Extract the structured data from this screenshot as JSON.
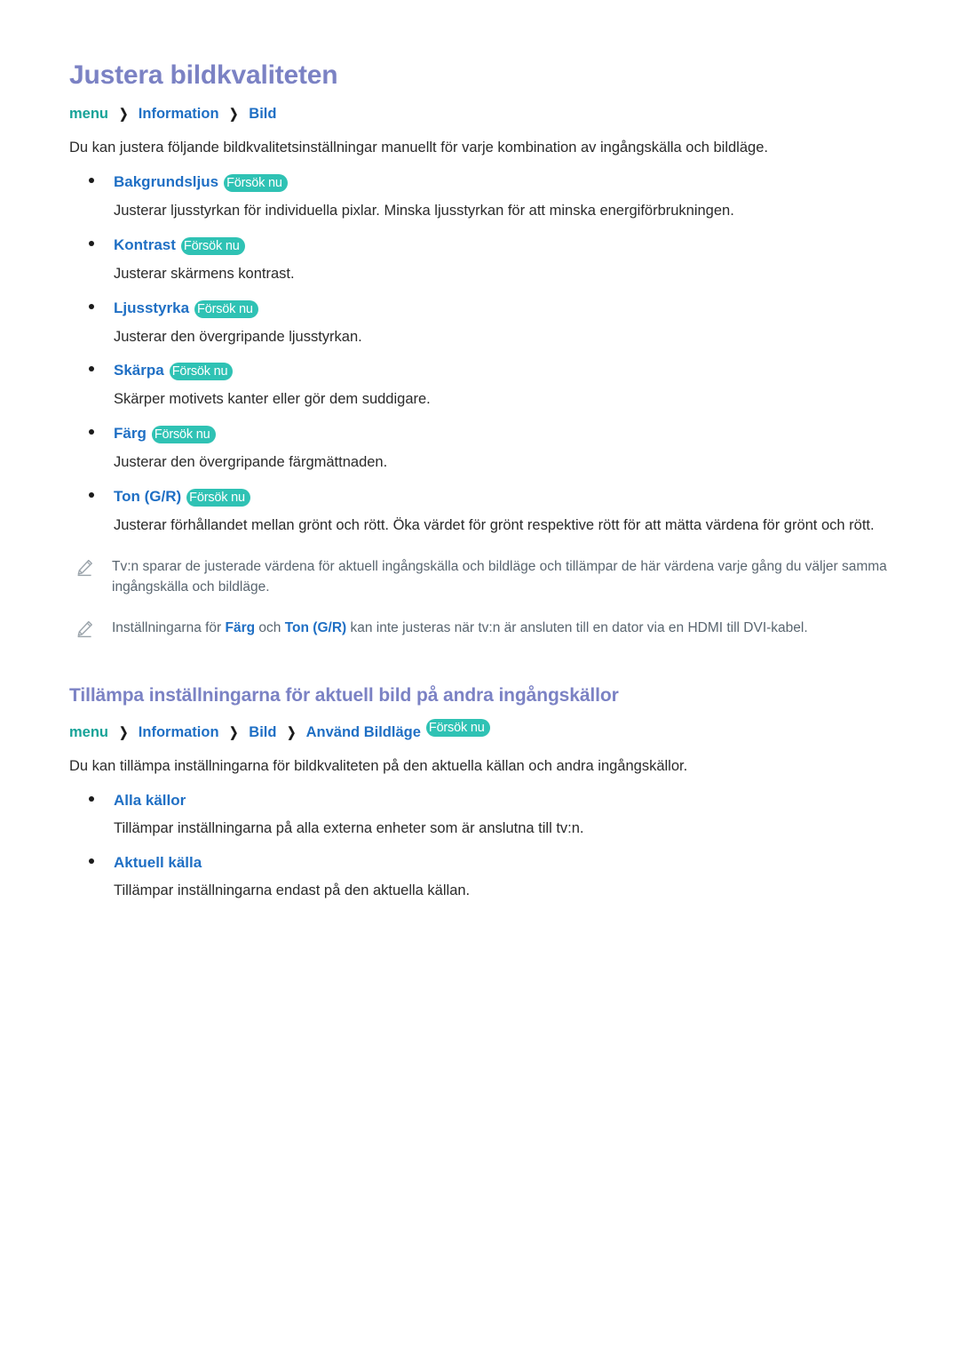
{
  "document": {
    "title": "Justera bildkvaliteten",
    "intro": "Du kan justera följande bildkvalitetsinställningar manuellt för varje kombination av ingångskälla och bildläge."
  },
  "colors": {
    "heading_purple": "#7b82c4",
    "link_blue": "#1f6fc4",
    "menu_teal": "#17a398",
    "badge_teal": "#2fc2b4",
    "body_text": "#2b2b2b",
    "note_text": "#5a6670",
    "page_background": "#ffffff"
  },
  "breadcrumb_main": {
    "separator": "❯",
    "items": [
      {
        "label": "menu",
        "style": "teal"
      },
      {
        "label": "Information",
        "style": "blue"
      },
      {
        "label": "Bild",
        "style": "blue"
      }
    ]
  },
  "badge": {
    "label": "Försök nu",
    "icon_name": "try-now-badge"
  },
  "settings_list": [
    {
      "label": "Bakgrundsljus",
      "badge": "Försök nu",
      "description": "Justerar ljusstyrkan för individuella pixlar. Minska ljusstyrkan för att minska energiförbrukningen."
    },
    {
      "label": "Kontrast",
      "badge": "Försök nu",
      "description": "Justerar skärmens kontrast."
    },
    {
      "label": "Ljusstyrka",
      "badge": "Försök nu",
      "description": "Justerar den övergripande ljusstyrkan."
    },
    {
      "label": "Skärpa",
      "badge": "Försök nu",
      "description": "Skärper motivets kanter eller gör dem suddigare."
    },
    {
      "label": "Färg",
      "badge": "Försök nu",
      "description": "Justerar den övergripande färgmättnaden."
    },
    {
      "label": "Ton (G/R)",
      "badge": "Försök nu",
      "description": "Justerar förhållandet mellan grönt och rött. Öka värdet för grönt respektive rött för att mätta värdena för grönt och rött."
    }
  ],
  "notes": [
    {
      "icon_name": "pencil-icon",
      "text_before": "Tv:n sparar de justerade värdena för aktuell ingångskälla och bildläge och tillämpar de här värdena varje gång du väljer samma ingångskälla och bildläge.",
      "highlight_1": "",
      "text_middle": "",
      "highlight_2": "",
      "text_after": ""
    },
    {
      "icon_name": "pencil-icon",
      "text_before": "Inställningarna för ",
      "highlight_1": "Färg",
      "text_middle": " och ",
      "highlight_2": "Ton (G/R)",
      "text_after": " kan inte justeras när tv:n är ansluten till en dator via en HDMI till DVI-kabel."
    }
  ],
  "section_two": {
    "title": "Tillämpa inställningarna för aktuell bild på andra ingångskällor",
    "breadcrumb": {
      "separator": "❯",
      "items": [
        {
          "label": "menu",
          "style": "teal"
        },
        {
          "label": "Information",
          "style": "blue"
        },
        {
          "label": "Bild",
          "style": "blue"
        },
        {
          "label": "Använd Bildläge",
          "style": "blue"
        }
      ],
      "badge": "Försök nu"
    },
    "intro": "Du kan tillämpa inställningarna för bildkvaliteten på den aktuella källan och andra ingångskällor.",
    "options": [
      {
        "label": "Alla källor",
        "description": "Tillämpar inställningarna på alla externa enheter som är anslutna till tv:n."
      },
      {
        "label": "Aktuell källa",
        "description": "Tillämpar inställningarna endast på den aktuella källan."
      }
    ]
  }
}
